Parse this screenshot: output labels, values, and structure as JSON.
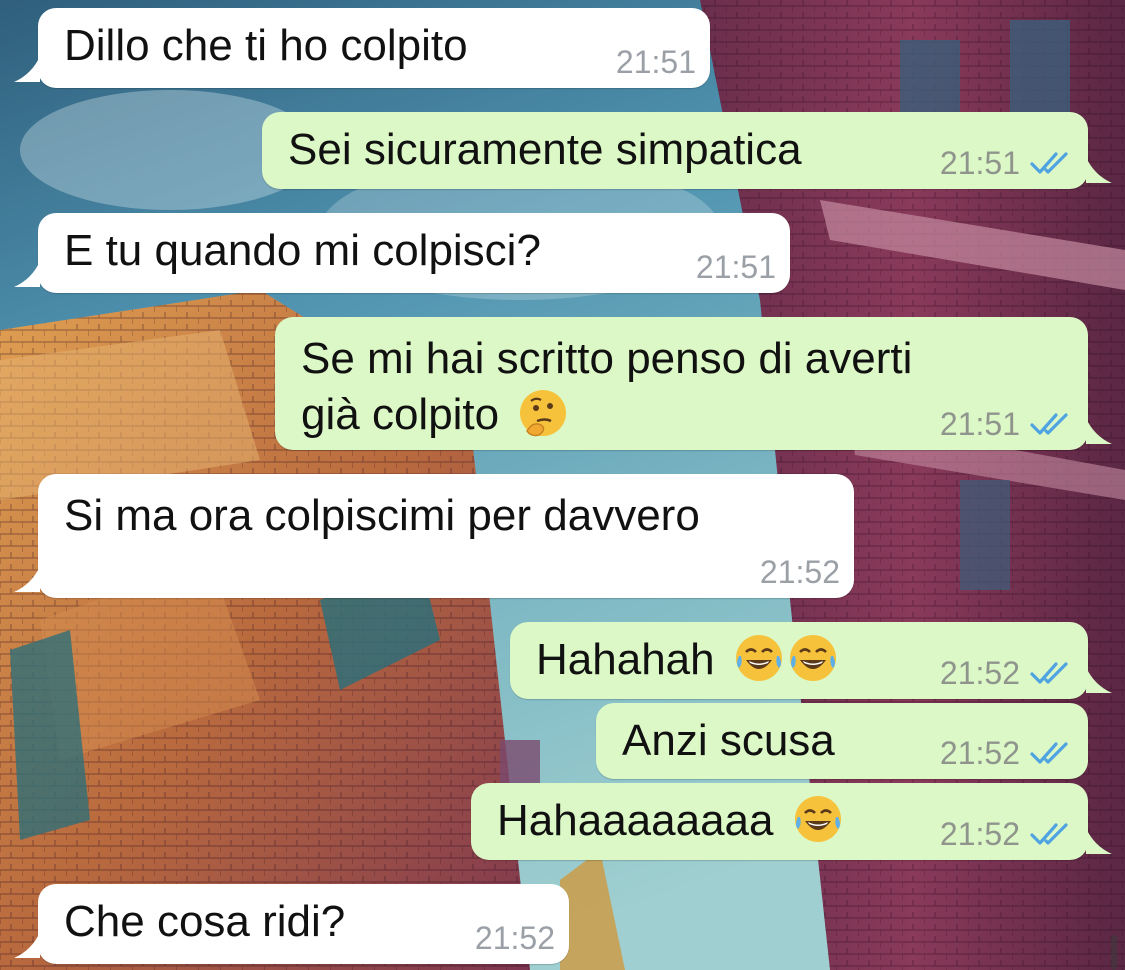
{
  "chat": {
    "messages": [
      {
        "direction": "in",
        "text": "Dillo che ti ho colpito",
        "time": "21:51"
      },
      {
        "direction": "out",
        "text": "Sei sicuramente simpatica",
        "time": "21:51",
        "status": "read"
      },
      {
        "direction": "in",
        "text": "E tu quando mi colpisci?",
        "time": "21:51"
      },
      {
        "direction": "out",
        "text_lines": [
          "Se mi hai scritto penso di averti",
          "già colpito"
        ],
        "emoji": [
          "thinking-face"
        ],
        "time": "21:51",
        "status": "read"
      },
      {
        "direction": "in",
        "text": "Si ma ora colpiscimi per davvero",
        "time": "21:52"
      },
      {
        "direction": "out",
        "text": "Hahahah",
        "emoji": [
          "tears-of-joy",
          "tears-of-joy"
        ],
        "time": "21:52",
        "status": "read"
      },
      {
        "direction": "out",
        "text": "Anzi scusa",
        "time": "21:52",
        "status": "read"
      },
      {
        "direction": "out",
        "text": "Hahaaaaaaaa",
        "emoji": [
          "tears-of-joy"
        ],
        "time": "21:52",
        "status": "read"
      },
      {
        "direction": "in",
        "text": "Che cosa ridi?",
        "time": "21:52"
      }
    ]
  },
  "colors": {
    "incoming_bubble": "#ffffff",
    "outgoing_bubble": "#dcf8c6",
    "read_ticks": "#4fa3e0",
    "timestamp": "#8f958d"
  }
}
